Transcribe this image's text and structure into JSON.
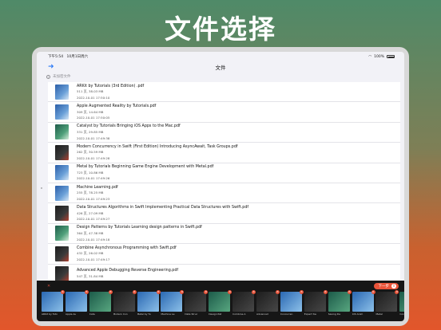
{
  "headline": "文件选择",
  "status": {
    "time": "下午5:54",
    "date": "10月1日周六",
    "battery": "100%"
  },
  "navbar": {
    "title": "文件",
    "back_icon": "back-arrow-icon"
  },
  "hint": "未加密文件",
  "files": [
    {
      "name": "ARKit by Tutorials (3rd Edition) .pdf",
      "info": "511 页, 38.03 MB",
      "date": "2022-10-01 17:50:10",
      "style": "blue"
    },
    {
      "name": "Apple Augmented Reality by Tutorials.pdf",
      "info": "309 页, 14.64 MB",
      "date": "2022-10-01 17:50:05",
      "style": "blue"
    },
    {
      "name": "Catalyst by Tutorials Bringing iOS Apps to the Mac.pdf",
      "info": "331 页, 29.85 MB",
      "date": "2022-10-01 17:49:38",
      "style": "green"
    },
    {
      "name": "Modern Concurrency in Swift (First Edition) Introducing AsyncAwait, Task Groups.pdf",
      "info": "262 页, 30.59 MB",
      "date": "2022-10-01 17:49:28",
      "style": "dark"
    },
    {
      "name": "Metal by Tutorials Beginning Game Engine Development with Metal.pdf",
      "info": "723 页, 10.86 MB",
      "date": "2022-10-01 17:49:26",
      "style": "blue"
    },
    {
      "name": "Machine Learning.pdf",
      "info": "255 页, 78.25 MB",
      "date": "2022-10-01 17:49:23",
      "style": "blue"
    },
    {
      "name": "Data Structures  Algorithms in Swift Implementing Practical Data Structures with Swift.pdf",
      "info": "426 页, 27.09 MB",
      "date": "2022-10-01 17:49:27",
      "style": "dark"
    },
    {
      "name": "Design Patterns by Tutorials Learning design patterns in Swift.pdf",
      "info": "364 页, 47.38 MB",
      "date": "2022-10-01 17:49:18",
      "style": "green"
    },
    {
      "name": "Combine Asynchronous Programming with Swift.pdf",
      "info": "432 页, 26.02 MB",
      "date": "2022-10-01 17:49:17",
      "style": "dark"
    },
    {
      "name": "Advanced Apple Debugging  Reverse Engineering.pdf",
      "info": "547 页, 31.84 MB",
      "date": "",
      "style": "dark"
    }
  ],
  "tray": {
    "close_icon": "close-icon",
    "next_label": "下一步",
    "next_count": "0",
    "items": [
      {
        "label": "ARKit by Tuto",
        "style": "blue"
      },
      {
        "label": "Apple Au",
        "style": "blue"
      },
      {
        "label": "Cata",
        "style": "green"
      },
      {
        "label": "Modern Con",
        "style": "dark"
      },
      {
        "label": "Metal by Tu",
        "style": "blue"
      },
      {
        "label": "Machine Le",
        "style": "blue"
      },
      {
        "label": "Data Struc",
        "style": "dark"
      },
      {
        "label": "Design Pat",
        "style": "green"
      },
      {
        "label": "Combine A",
        "style": "dark"
      },
      {
        "label": "Advanced",
        "style": "dark"
      },
      {
        "label": "Concurren",
        "style": "blue"
      },
      {
        "label": "Expert Sw",
        "style": "dark"
      },
      {
        "label": "Saving Da",
        "style": "green"
      },
      {
        "label": "iOS Anim",
        "style": "blue"
      },
      {
        "label": "Metal",
        "style": "dark"
      },
      {
        "label": "Core Data",
        "style": "green"
      }
    ]
  }
}
